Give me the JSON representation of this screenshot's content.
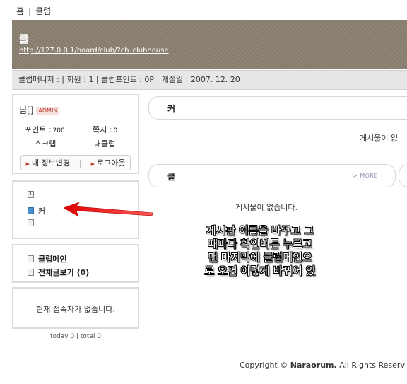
{
  "breadcrumb": {
    "home": "홈",
    "separator": "|",
    "club": "클럽"
  },
  "banner": {
    "title": "클",
    "url": "http://127.0.0.1/board/club/?cb_clubhouse"
  },
  "infobar": {
    "text": "클럽매니저 : | 회원 : 1 | 클럽포인트 : 0P | 개설일 : 2007. 12. 20"
  },
  "profile": {
    "name": "님[]",
    "badge": "ADMIN",
    "points_label": "포인트 :",
    "points_value": "200",
    "memo_label": "쪽지 :",
    "memo_value": "0",
    "scrap": "스크랩",
    "my_club": "내클럽",
    "edit_info": "내 정보변경",
    "logout": "로그아웃"
  },
  "menu": {
    "items": [
      "",
      "커",
      ""
    ]
  },
  "links": {
    "club_main": "클럽메인",
    "all_posts": "전체글보기",
    "all_posts_count": "(0)"
  },
  "visitor": {
    "text": "현재 접속자가 없습니다."
  },
  "today": {
    "text": "today 0 | total 0"
  },
  "boards": [
    {
      "title": "커",
      "empty": "게시물이 없"
    },
    {
      "title": "클",
      "more": "MORE",
      "empty": "게시물이 없습니다."
    }
  ],
  "annotation": {
    "lines": [
      "게시판 이름을 바꾸고 그",
      "때마다 확인버튼 누르고",
      "맨 마지막에 클럽메인으",
      "로 오면 이렇게 바뀌어 있"
    ]
  },
  "footer": {
    "prefix": "Copyright ©",
    "brand": "Naraorum.",
    "suffix": "All Rights Reserv"
  },
  "colors": {
    "banner": "#8a7f70",
    "arrow": "#e00000",
    "badge": "#c0392b"
  }
}
